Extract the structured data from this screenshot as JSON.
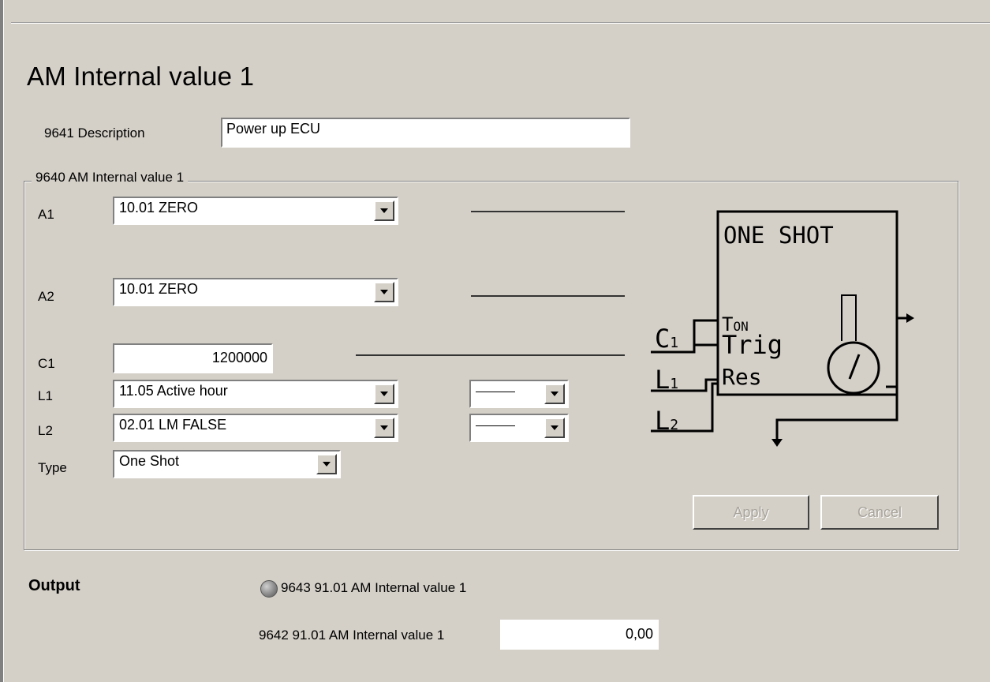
{
  "page": {
    "title": "AM Internal value 1"
  },
  "description": {
    "label": "9641 Description",
    "value": "Power up ECU"
  },
  "group": {
    "legend": "9640 AM Internal value 1",
    "rows": {
      "a1": {
        "label": "A1",
        "value": "10.01 ZERO"
      },
      "a2": {
        "label": "A2",
        "value": "10.01 ZERO"
      },
      "c1": {
        "label": "C1",
        "value": "1200000"
      },
      "l1": {
        "label": "L1",
        "value": "11.05 Active hour"
      },
      "l2": {
        "label": "L2",
        "value": "02.01 LM FALSE"
      },
      "type": {
        "label": "Type",
        "value": "One Shot"
      }
    },
    "buttons": {
      "apply": "Apply",
      "cancel": "Cancel"
    }
  },
  "diagram": {
    "title": "ONE SHOT",
    "inputs": [
      "TON",
      "Trig",
      "Res"
    ],
    "labels": [
      "C1",
      "L1",
      "L2"
    ]
  },
  "output": {
    "title": "Output",
    "indicator_label": "9643 91.01 AM Internal value 1",
    "value_label": "9642 91.01 AM Internal value 1",
    "value": "0,00"
  },
  "colors": {
    "background": "#d4d0c8",
    "disabled_text": "#a8a49c"
  }
}
